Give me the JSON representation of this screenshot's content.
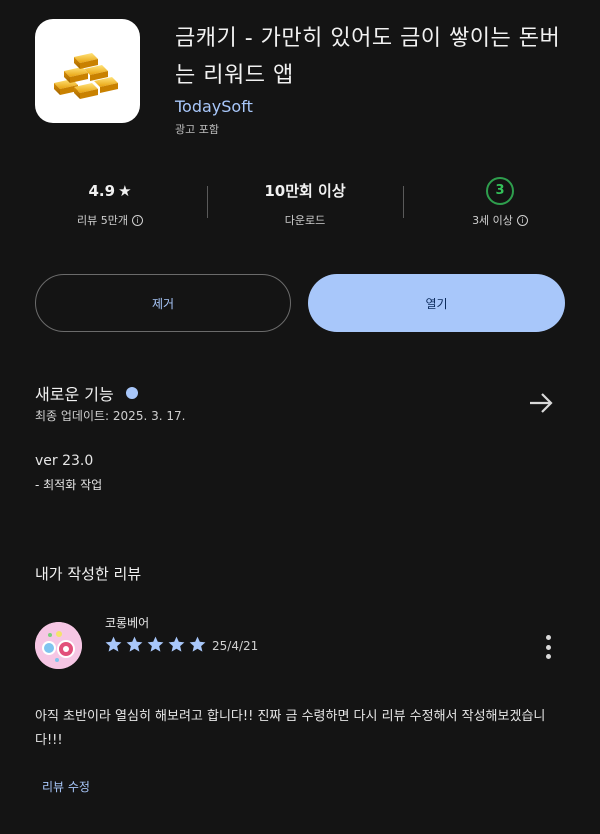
{
  "app": {
    "title": "금캐기 - 가만히 있어도 금이 쌓이는 돈버는 리워드 앱",
    "developer": "TodaySoft",
    "ads_label": "광고 포함",
    "icon": "gold-bars-icon"
  },
  "stats": {
    "rating": {
      "value": "4.9",
      "label": "리뷰 5만개"
    },
    "downloads": {
      "value": "10만회 이상",
      "label": "다운로드"
    },
    "age": {
      "value": "3",
      "label": "3세 이상"
    }
  },
  "buttons": {
    "remove": "제거",
    "open": "열기"
  },
  "whats_new": {
    "title": "새로운 기능",
    "updated": "최종 업데이트: 2025. 3. 17.",
    "version": "ver 23.0",
    "changes": "- 최적화 작업"
  },
  "my_review": {
    "title": "내가 작성한 리뷰",
    "reviewer": "코롱베어",
    "stars": 5,
    "date": "25/4/21",
    "text": "아직 초반이라 열심히 해보려고 합니다!! 진짜 금 수령하면 다시 리뷰 수정해서 작성해보겠습니다!!!",
    "edit_label": "리뷰 수정"
  },
  "colors": {
    "accent": "#a8c7fa",
    "background": "#141414",
    "age_badge": "#2e9e4d"
  }
}
